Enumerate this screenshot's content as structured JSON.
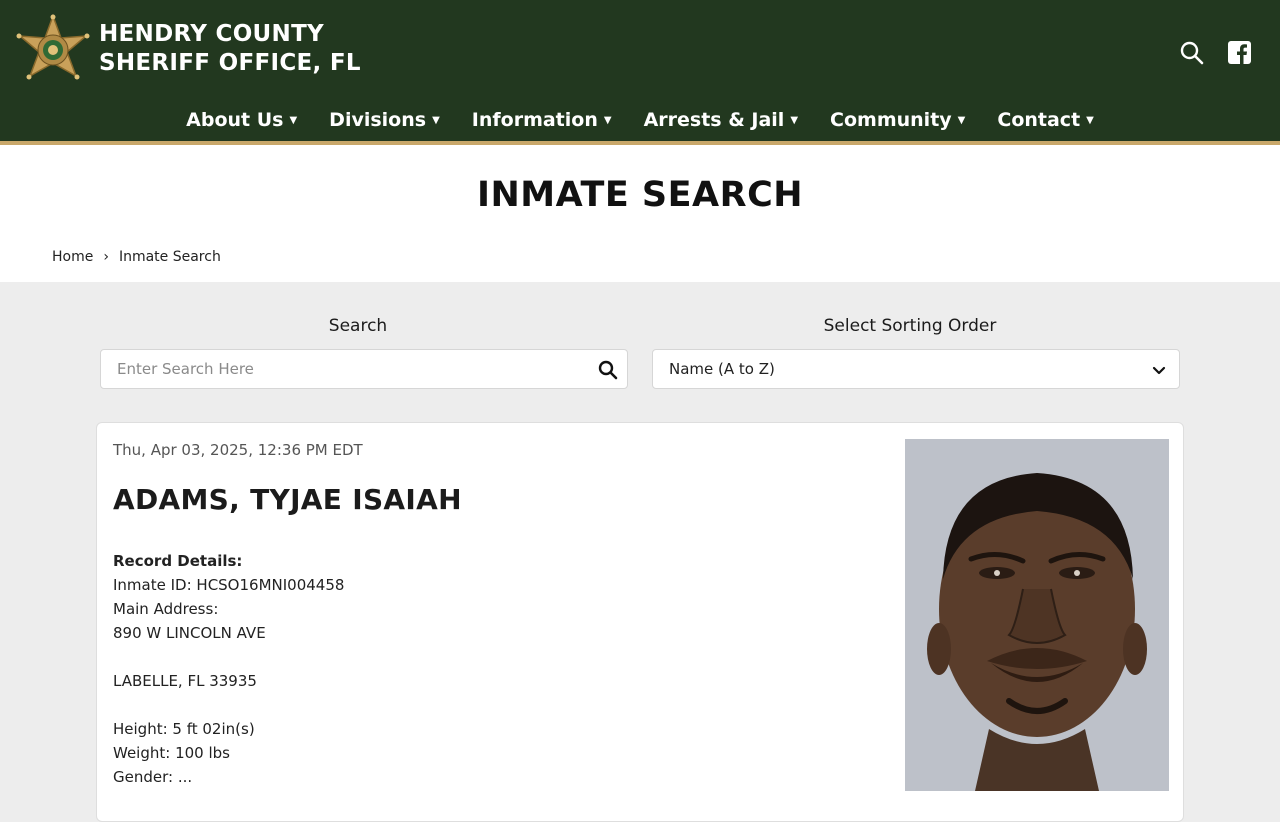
{
  "header": {
    "title_line1": "HENDRY COUNTY",
    "title_line2": "SHERIFF OFFICE, FL",
    "icons": [
      "search-icon",
      "facebook-icon"
    ],
    "colors": {
      "bg": "#22381f",
      "accent": "#c9a86a"
    }
  },
  "nav": {
    "items": [
      {
        "label": "About Us"
      },
      {
        "label": "Divisions"
      },
      {
        "label": "Information"
      },
      {
        "label": "Arrests & Jail"
      },
      {
        "label": "Community"
      },
      {
        "label": "Contact"
      }
    ]
  },
  "page": {
    "title": "INMATE SEARCH",
    "breadcrumb": {
      "home": "Home",
      "separator": "›",
      "current": "Inmate Search"
    }
  },
  "search": {
    "label": "Search",
    "placeholder": "Enter Search Here",
    "value": ""
  },
  "sort": {
    "label": "Select Sorting Order",
    "selected": "Name (A to Z)"
  },
  "record": {
    "date": "Thu, Apr 03, 2025, 12:36 PM EDT",
    "name": "ADAMS, TYJAE ISAIAH",
    "details_header": "Record Details:",
    "inmate_id": "Inmate ID: HCSO16MNI004458",
    "address_label": "Main Address:",
    "address_line1": "890 W LINCOLN AVE",
    "address_line2": "LABELLE, FL 33935",
    "height": "Height: 5 ft 02in(s)",
    "weight": "Weight: 100 lbs",
    "gender": "Gender: ..."
  }
}
